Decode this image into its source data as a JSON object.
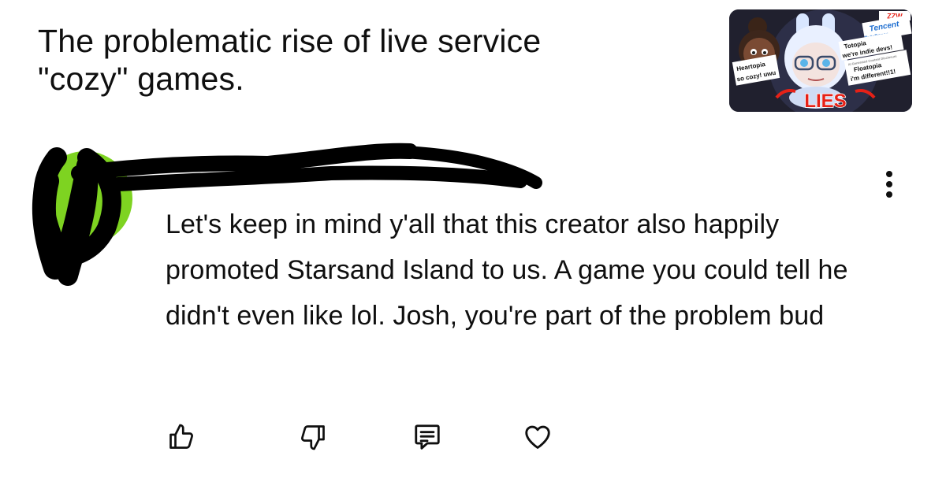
{
  "video": {
    "title": "The problematic rise of live service\n\"cozy\" games.",
    "thumbnail": {
      "labels": {
        "logo": "ZZW",
        "tencent": "Tencent",
        "bytedance": "ByteDance",
        "totopia": "Totopia",
        "indie": "we're indie devs!",
        "disclosure": "AI Generated Content Disclosure",
        "floatopia": "Floatopia",
        "different": "i'm different!!1!",
        "heartopia": "Heartopia",
        "cozy": "so cozy! uwu",
        "lies": "LIES"
      },
      "accent_color": "#e62117"
    }
  },
  "comment": {
    "text": "Let's keep in mind y'all that this creator also happily promoted Starsand Island to us. A game you could tell he didn't even like lol. Josh, you're part of the problem bud",
    "avatar_color": "#7ed321",
    "redaction_color": "#000000"
  },
  "actions": {
    "like_icon": "thumbs-up-icon",
    "dislike_icon": "thumbs-down-icon",
    "reply_icon": "comment-icon",
    "heart_icon": "heart-icon",
    "more_icon": "more-vertical-icon"
  }
}
